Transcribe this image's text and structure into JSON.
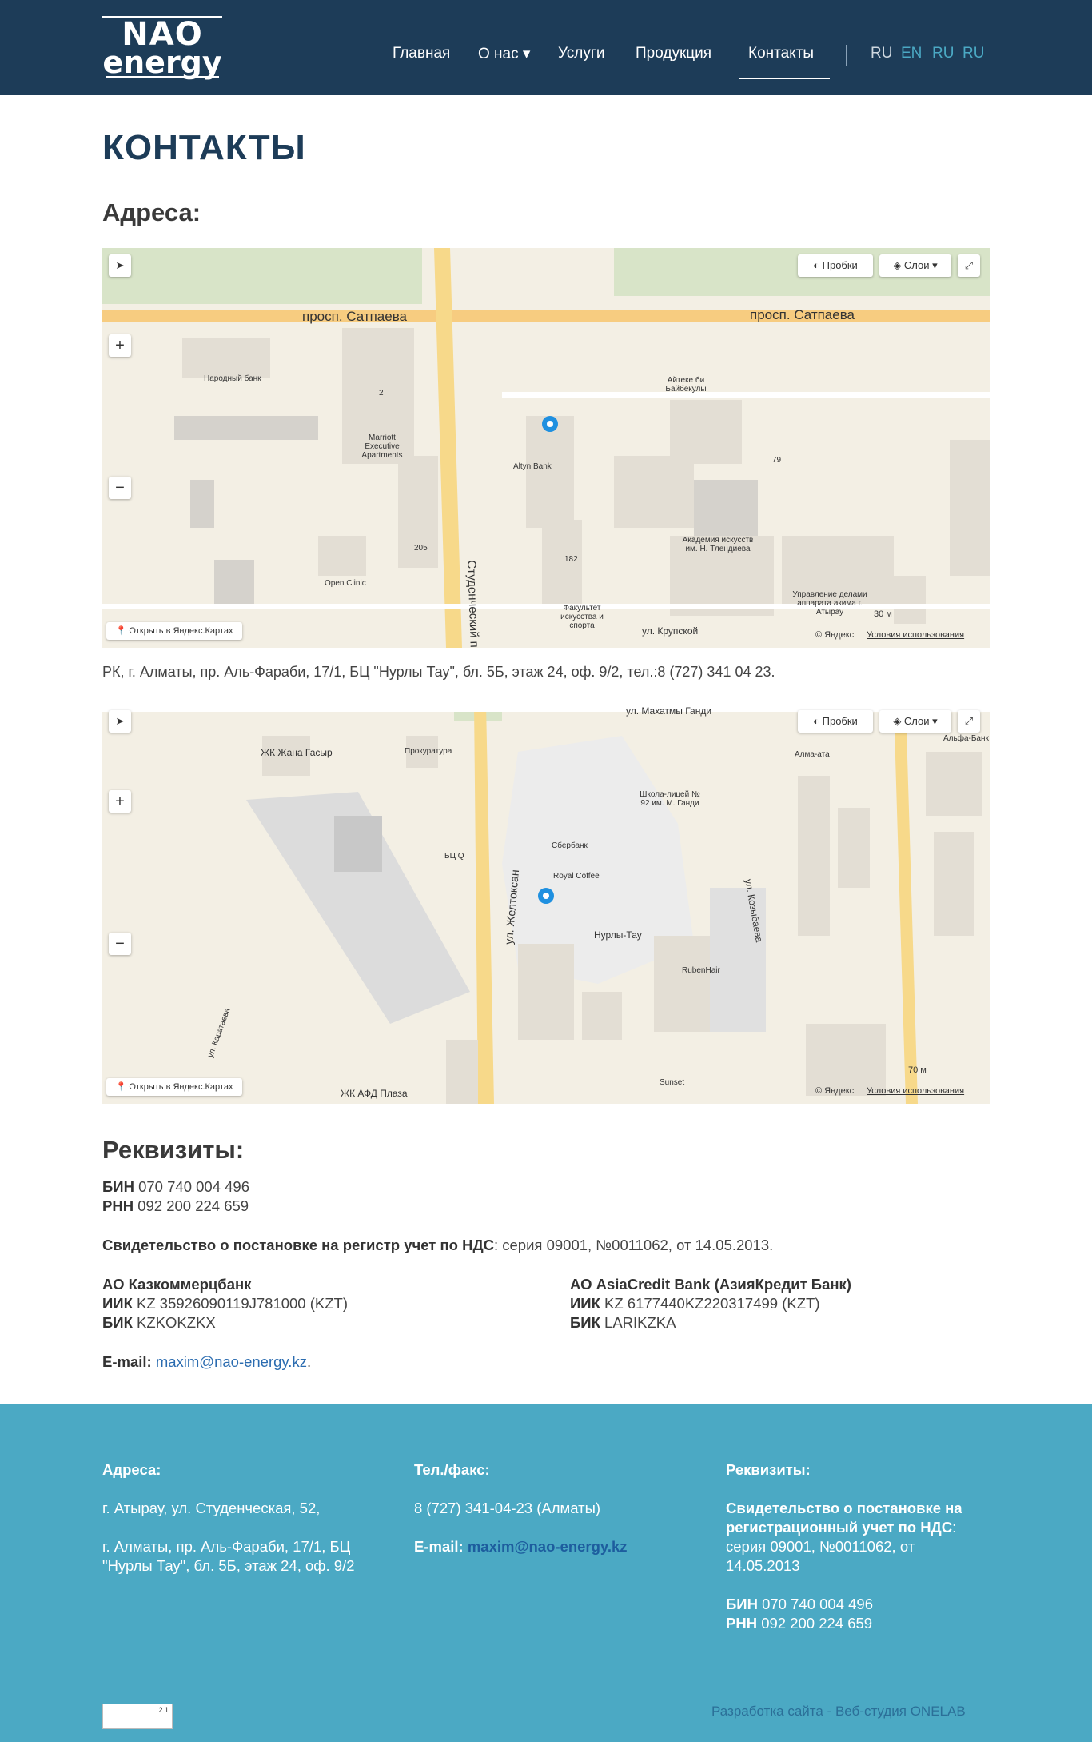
{
  "header": {
    "logo_line1": "NAO",
    "logo_line2": "energy",
    "nav": [
      {
        "label": "Главная"
      },
      {
        "label": "О нас ▾"
      },
      {
        "label": "Услуги"
      },
      {
        "label": "Продукция"
      },
      {
        "label": "Контакты"
      }
    ],
    "langs": [
      "RU",
      "EN",
      "RU",
      "RU"
    ]
  },
  "page": {
    "title": "КОНТАКТЫ",
    "addresses_heading": "Адреса:",
    "address_text": "РК, г. Алматы, пр. Аль-Фараби, 17/1, БЦ \"Нурлы Тау\", бл. 5Б, этаж 24, оф. 9/2, тел.:8 (727) 341 04 23."
  },
  "map1": {
    "traffic_label": "Пробки",
    "layers_label": "Слои",
    "open_label": "Открыть в Яндекс.Картах",
    "attribution": "© Яндекс",
    "terms": "Условия использования",
    "scale": "30 м",
    "labels": [
      "просп. Сатпаева",
      "просп. Сатпаева",
      "Народный банк",
      "Marriott Executive Apartments",
      "Altyn Bank",
      "Айтеке би Байбекулы",
      "Академия искусств им. Н. Тлендиева",
      "Open Clinic",
      "Факультет искусства и спорта",
      "Студенческий пр.",
      "ул. Крупской",
      "Управление делами аппарата акима г. Атырау",
      "205",
      "182",
      "79",
      "2"
    ]
  },
  "map2": {
    "traffic_label": "Пробки",
    "layers_label": "Слои",
    "open_label": "Открыть в Яндекс.Картах",
    "attribution": "© Яндекс",
    "terms": "Условия использования",
    "scale": "70 м",
    "labels": [
      "ул. Махатмы Ганди",
      "ЖК Жана Гасыр",
      "Прокуратура",
      "ул. Желтоксан",
      "Школа-лицей № 92 им. М. Ганди",
      "Сбербанк",
      "Royal Coffee",
      "Нурлы-Тау",
      "RubenHair",
      "БЦ Q",
      "ул. Козыбаева",
      "Алма-ата",
      "Альфа-Банк",
      "ЖК АФД Плаза",
      "Sunset",
      "ул. Каратаева"
    ]
  },
  "requisites": {
    "heading": "Реквизиты:",
    "bin_label": "БИН",
    "bin": "070 740 004 496",
    "rnn_label": "РНН",
    "rnn": "092 200 224 659",
    "vat_label": "Свидетельство о постановке на регистр учет по НДС",
    "vat_value": ": серия 09001, №0011062, от 14.05.2013.",
    "bank1": {
      "name": "АО Казкоммерцбанк",
      "iik_label": "ИИК",
      "iik": "KZ 35926090119J781000 (KZT)",
      "bik_label": "БИК",
      "bik": "KZKOKZKX"
    },
    "bank2": {
      "name": "АО AsiaCredit Bank (АзияКредит Банк)",
      "iik_label": "ИИК",
      "iik": "KZ 6177440KZ220317499 (KZT)",
      "bik_label": "БИК",
      "bik": "LARIKZKA"
    },
    "email_label": "E-mail:",
    "email": "maxim@nao-energy.kz",
    "email_suffix": "."
  },
  "footer": {
    "col1_head": "Адреса:",
    "col1_line1": "г. Атырау, ул. Студенческая, 52,",
    "col1_line2": "г. Алматы, пр. Аль-Фараби, 17/1, БЦ \"Нурлы Тау\", бл. 5Б, этаж 24, оф. 9/2",
    "col2_head": "Тел./факс:",
    "col2_phone": "8 (727) 341-04-23 (Алматы)",
    "col2_email_label": "E-mail:",
    "col2_email": "maxim@nao-energy.kz",
    "col3_head": "Реквизиты:",
    "col3_vat_label": "Свидетельство о постановке на регистрационный учет по НДС",
    "col3_vat_value": ": серия 09001, №0011062, от 14.05.2013",
    "col3_bin_label": "БИН",
    "col3_bin": "070 740 004 496",
    "col3_rnn_label": "РНН",
    "col3_rnn": "092 200 224 659",
    "credit": "Разработка сайта - Веб-студия ONELAB",
    "counter_text": "2 1"
  },
  "colors": {
    "header_bg": "#1d3c58",
    "footer_bg": "#4ba9c4",
    "link": "#2b6cb0"
  }
}
